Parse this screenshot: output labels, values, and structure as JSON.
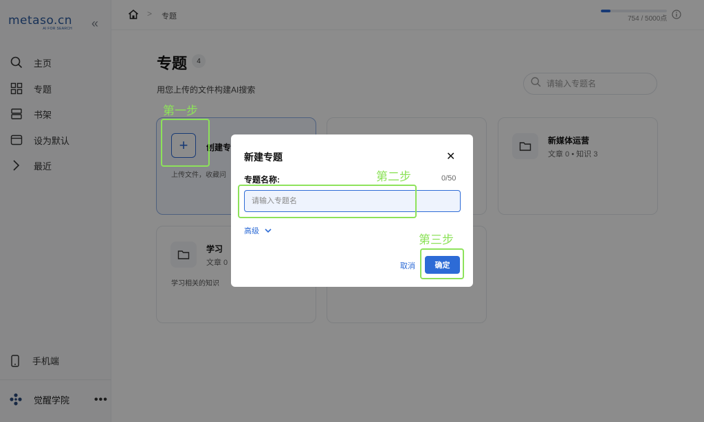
{
  "sidebar": {
    "logo": "metaso.cn",
    "logo_sub": "AI FOR SEARCH",
    "collapse_icon": "«",
    "items": [
      {
        "label": "主页",
        "icon": "search-icon"
      },
      {
        "label": "专题",
        "icon": "grid-icon"
      },
      {
        "label": "书架",
        "icon": "bookshelf-icon"
      },
      {
        "label": "设为默认",
        "icon": "window-icon"
      },
      {
        "label": "最近",
        "icon": "chevron-right-icon"
      }
    ],
    "mobile_label": "手机端",
    "user_name": "觉醒学院",
    "more": "•••"
  },
  "topbar": {
    "breadcrumb_sep": ">",
    "breadcrumb": "专题",
    "quota_text": "754 / 5000点",
    "quota_fraction": 0.15
  },
  "main": {
    "title": "专题",
    "count": "4",
    "subtitle": "用您上传的文件构建AI搜索",
    "search_placeholder": "请输入专题名",
    "create_card": {
      "plus": "+",
      "title": "创建专",
      "desc": "上传文件，收藏问"
    },
    "topics": [
      {
        "name": "新媒体运营",
        "meta": "文章 0 • 知识 3",
        "desc": ""
      },
      {
        "name": "学习",
        "meta": "文章 0",
        "desc": "学习相关的知识"
      }
    ]
  },
  "modal": {
    "title": "新建专题",
    "close": "✕",
    "field_label": "专题名称:",
    "char_count": "0/50",
    "input_placeholder": "请输入专题名",
    "input_value": "",
    "advanced": "高级",
    "cancel": "取消",
    "confirm": "确定"
  },
  "annotations": {
    "step1": "第一步",
    "step2": "第二步",
    "step3": "第三步",
    "color": "#8de25a"
  },
  "colors": {
    "accent": "#2d6bd6",
    "brand": "#2b5a9e"
  }
}
